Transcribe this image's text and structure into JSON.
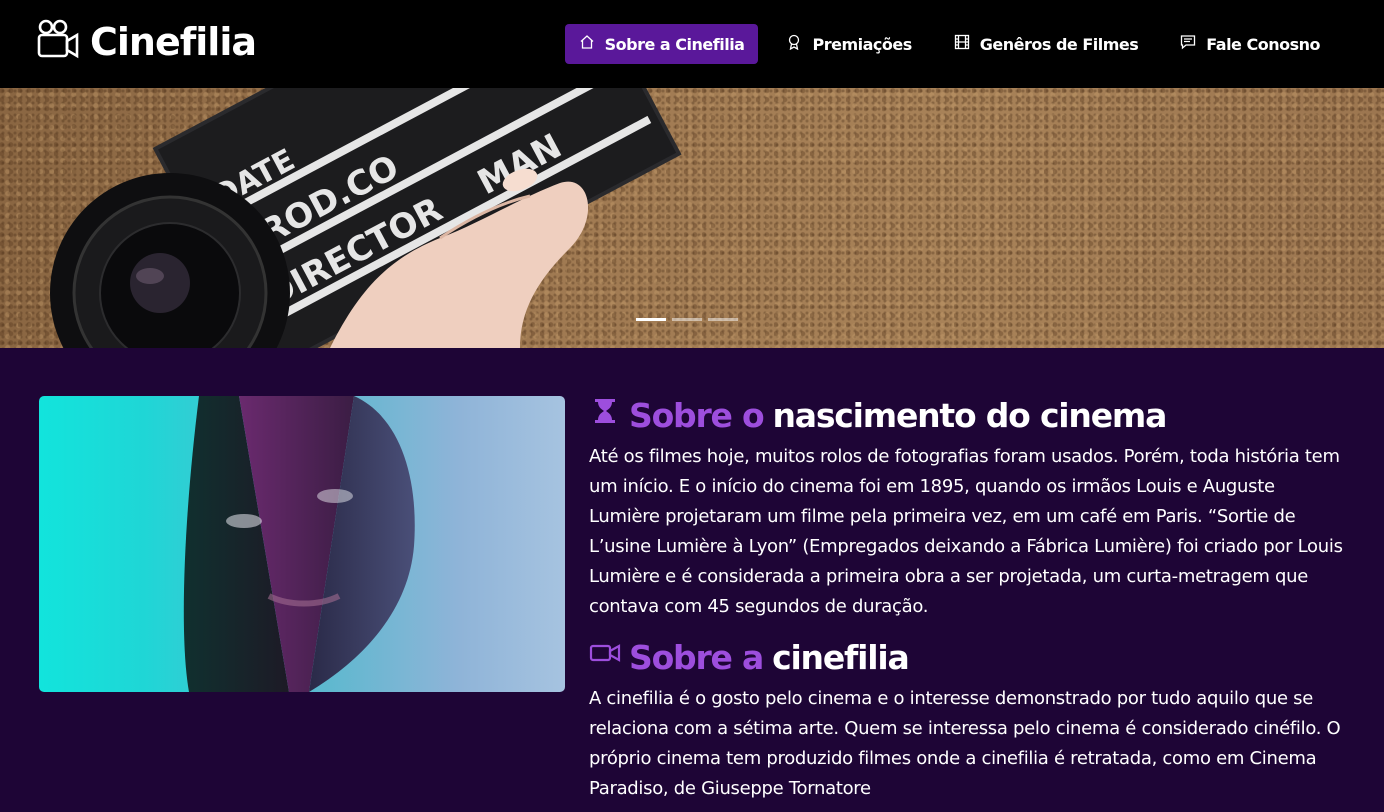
{
  "brand": {
    "name": "Cinefilia",
    "icon": "video-camera-icon"
  },
  "nav": {
    "items": [
      {
        "label": "Sobre a Cinefilia",
        "icon": "house-icon",
        "active": true
      },
      {
        "label": "Premiações",
        "icon": "award-icon",
        "active": false
      },
      {
        "label": "Genêros de Filmes",
        "icon": "film-icon",
        "active": false
      },
      {
        "label": "Fale Conosno",
        "icon": "chat-icon",
        "active": false
      }
    ]
  },
  "hero": {
    "slate_text": [
      "DATE",
      "PROD.CO",
      "DIRECTOR",
      "MAN"
    ],
    "indicators": [
      true,
      false,
      false
    ]
  },
  "sections": [
    {
      "icon": "hourglass-icon",
      "title_accent": "Sobre o",
      "title_rest": "nascimento do cinema",
      "body": "Até os filmes hoje, muitos rolos de fotografias foram usados. Porém, toda história tem um início. E o início do cinema foi em 1895, quando os irmãos Louis e Auguste Lumière projetaram um filme pela primeira vez, em um café em Paris. “Sortie de L’usine Lumière à Lyon” (Empregados deixando a Fábrica Lumière) foi criado por Louis Lumière e é considerada a primeira obra a ser projetada, um curta-metragem que contava com 45 segundos de duração."
    },
    {
      "icon": "camera-video-icon",
      "title_accent": "Sobre a",
      "title_rest": "cinefilia",
      "body": "A cinefilia é o gosto pelo cinema e o interesse demonstrado por tudo aquilo que se relaciona com a sétima arte. Quem se interessa pelo cinema é considerado cinéfilo. O próprio cinema tem produzido filmes onde a cinefilia é retratada, como em Cinema Paradiso, de Giuseppe Tornatore"
    }
  ],
  "colors": {
    "accent": "#9d4edd",
    "active_nav": "#5a189a",
    "page_bg": "#1e0536",
    "navbar_bg": "#000000"
  }
}
